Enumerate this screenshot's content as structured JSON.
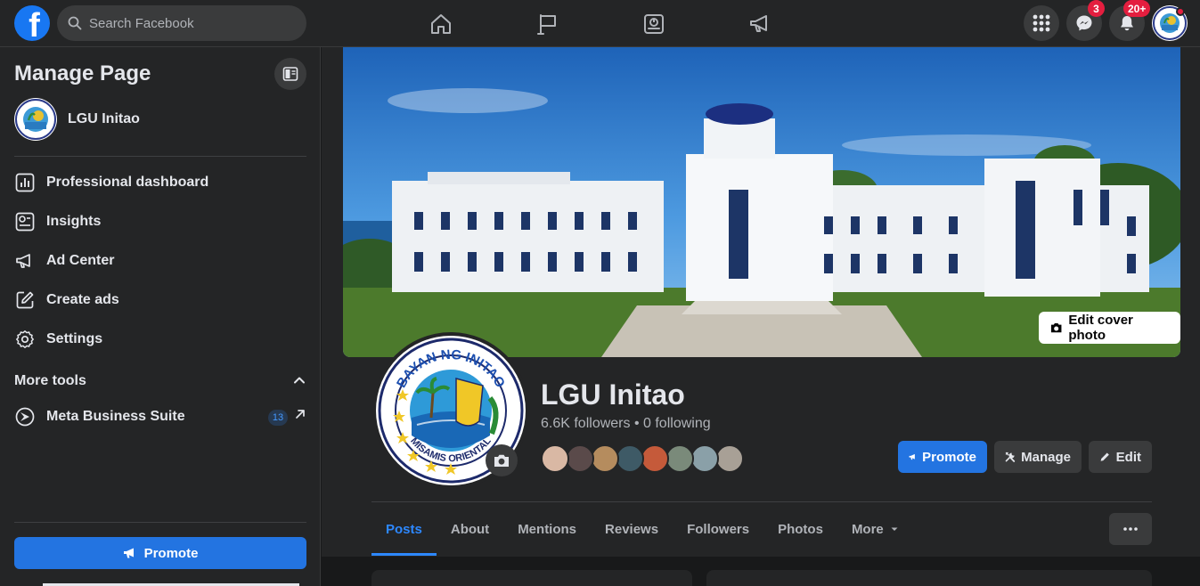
{
  "topbar": {
    "logo_letter": "f",
    "search_placeholder": "Search Facebook",
    "nav_icons": [
      "home-icon",
      "pages-flag-icon",
      "dashboard-icon",
      "megaphone-icon"
    ],
    "messenger_badge": "3",
    "notifications_badge": "20+"
  },
  "sidebar": {
    "title": "Manage Page",
    "page_name": "LGU Initao",
    "items": [
      {
        "label": "Professional dashboard",
        "icon": "chart-icon"
      },
      {
        "label": "Insights",
        "icon": "insights-icon"
      },
      {
        "label": "Ad Center",
        "icon": "megaphone-icon"
      },
      {
        "label": "Create ads",
        "icon": "pencil-square-icon"
      },
      {
        "label": "Settings",
        "icon": "gear-icon"
      }
    ],
    "more_tools_label": "More tools",
    "meta_business_label": "Meta Business Suite",
    "meta_business_count": "13",
    "promote_label": "Promote"
  },
  "profile": {
    "edit_cover_label": "Edit cover photo",
    "page_name": "LGU Initao",
    "followers": "6.6K followers",
    "separator": "•",
    "following": "0 following",
    "logo_top_text": "BAYAN NG INITAO",
    "logo_bottom_text": "MISAMIS ORIENTAL",
    "follower_colors": [
      "#d9b8a4",
      "#5a4a4a",
      "#b58c5e",
      "#3e5a66",
      "#c55a3a",
      "#7a8a7a",
      "#8aa0a8",
      "#a8a096"
    ],
    "buttons": {
      "promote": "Promote",
      "manage": "Manage",
      "edit": "Edit"
    }
  },
  "tabs": {
    "items": [
      "Posts",
      "About",
      "Mentions",
      "Reviews",
      "Followers",
      "Photos",
      "More"
    ],
    "active": "Posts"
  },
  "colors": {
    "accent": "#2374e1",
    "active_tab": "#2d88ff",
    "badge": "#e41e3f"
  }
}
